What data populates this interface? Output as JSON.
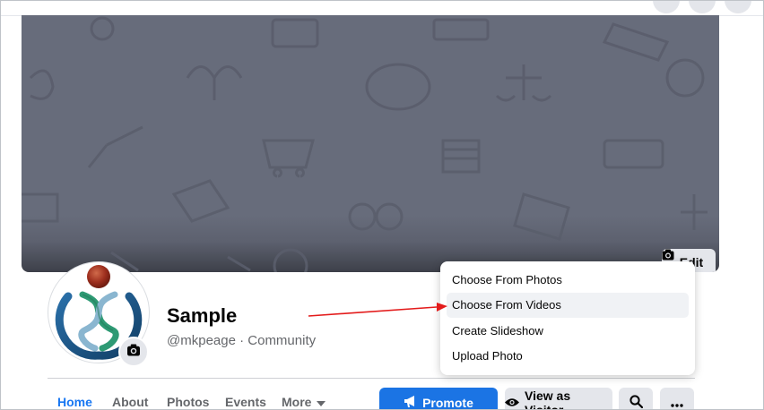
{
  "cover": {
    "edit_label": "Edit"
  },
  "profile": {
    "name": "Sample",
    "subtitle": "@mkpeage · Community"
  },
  "tabs": [
    {
      "label": "Home"
    },
    {
      "label": "About"
    },
    {
      "label": "Photos"
    },
    {
      "label": "Events"
    },
    {
      "label": "More"
    }
  ],
  "actions": {
    "promote_label": "Promote",
    "visitor_label": "View as Visitor"
  },
  "cover_menu": {
    "items": [
      {
        "label": "Choose From Photos"
      },
      {
        "label": "Choose From Videos"
      },
      {
        "label": "Create Slideshow"
      },
      {
        "label": "Upload Photo"
      }
    ]
  },
  "icons": {
    "camera": "camera-icon",
    "megaphone": "megaphone-icon",
    "eye": "eye-icon",
    "search": "search-icon",
    "ellipsis": "ellipsis-icon",
    "caret": "caret-down-icon"
  },
  "colors": {
    "accent": "#1877f2",
    "annotation_arrow": "#e31b1b",
    "cover_bg": "#676c7b"
  }
}
